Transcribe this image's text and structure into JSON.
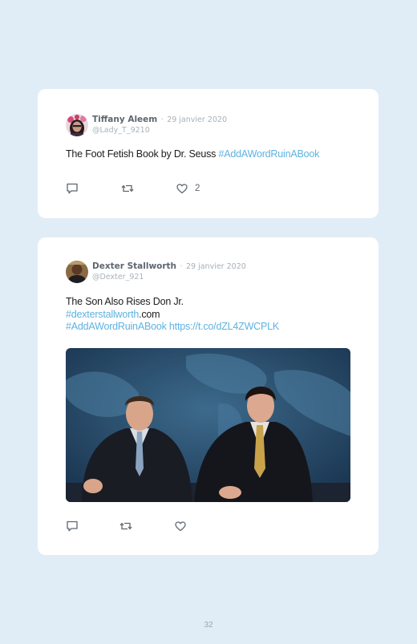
{
  "tweets": [
    {
      "author": "Tiffany Aleem",
      "separator": "·",
      "date": "29 janvier 2020",
      "handle": "@Lady_T_9210",
      "text_plain": "The Foot Fetish Book by Dr. Seuss ",
      "text_tag": "#AddAWordRuinABook",
      "likes": "2"
    },
    {
      "author": "Dexter Stallworth",
      "separator": "·",
      "date": "29 janvier 2020",
      "handle": "@Dexter_921",
      "line1": "The Son Also Rises Don Jr.",
      "line2_tag": "#dexterstallworth",
      "line2_rest": ".com",
      "line3_tag": "#AddAWordRuinABook https://t.co/dZL4ZWCPLK"
    }
  ],
  "icons": [
    "reply-icon",
    "retweet-icon",
    "like-icon"
  ],
  "colors": {
    "background": "#e1edf6",
    "card": "#ffffff",
    "hashtag": "#5fb2e0",
    "icon": "#5e6670"
  },
  "page_number": "32"
}
